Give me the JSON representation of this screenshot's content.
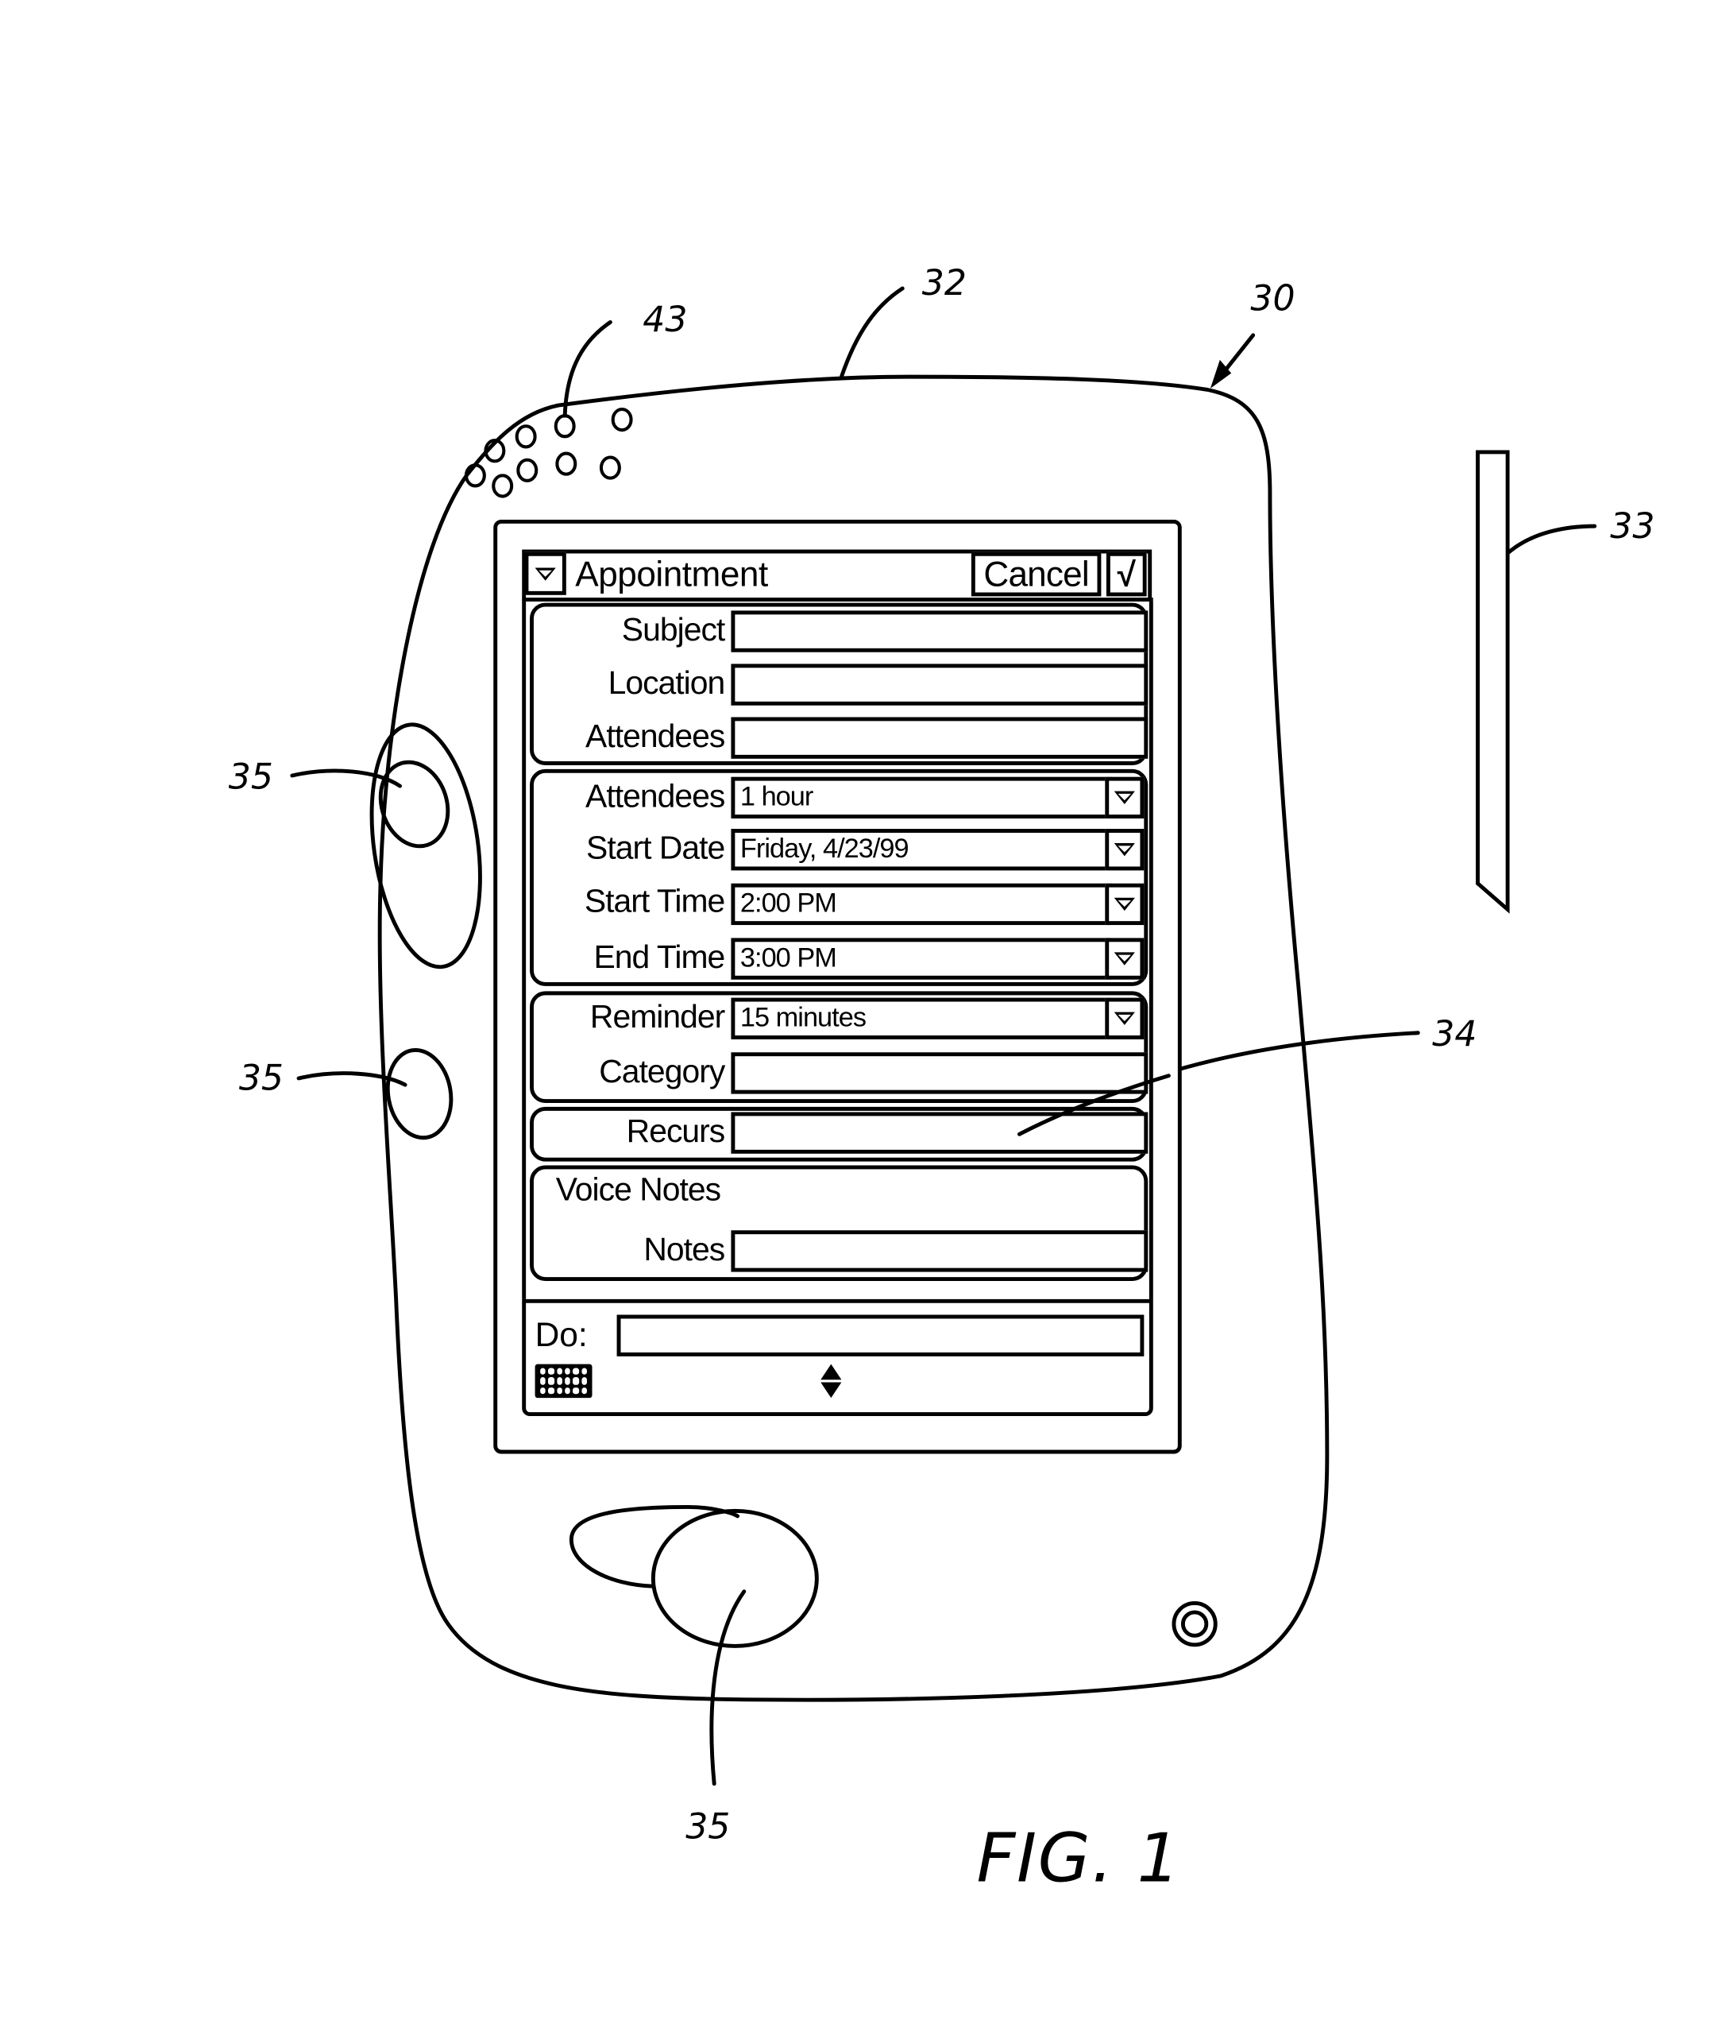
{
  "figure": {
    "label": "FIG. 1",
    "reference_numerals": {
      "device": "30",
      "housing": "32",
      "stylus": "33",
      "display": "34",
      "buttons": "35",
      "speaker": "43"
    }
  },
  "screen": {
    "title": "Appointment",
    "cancel_label": "Cancel",
    "ok_label": "√",
    "icons": {
      "menu": "triangle-down-icon",
      "dropdown": "triangle-down-icon",
      "keyboard": "keyboard-icon",
      "scroll": "up-down-arrows-icon"
    },
    "groups": [
      {
        "fields": [
          {
            "label": "Subject",
            "value": "",
            "dropdown": false
          },
          {
            "label": "Location",
            "value": "",
            "dropdown": false
          },
          {
            "label": "Attendees",
            "value": "",
            "dropdown": false
          }
        ]
      },
      {
        "fields": [
          {
            "label": "Attendees",
            "value": "1 hour",
            "dropdown": true
          },
          {
            "label": "Start Date",
            "value": "Friday, 4/23/99",
            "dropdown": true
          },
          {
            "label": "Start Time",
            "value": "2:00 PM",
            "dropdown": true
          },
          {
            "label": "End Time",
            "value": "3:00 PM",
            "dropdown": true
          }
        ]
      },
      {
        "fields": [
          {
            "label": "Reminder",
            "value": "15 minutes",
            "dropdown": true
          },
          {
            "label": "Category",
            "value": "",
            "dropdown": false
          }
        ]
      },
      {
        "fields": [
          {
            "label": "Recurs",
            "value": "",
            "dropdown": false
          }
        ]
      },
      {
        "heading": "Voice Notes",
        "fields": [
          {
            "label": "Notes",
            "value": "",
            "dropdown": false
          }
        ]
      }
    ],
    "command_bar": {
      "do_label": "Do:",
      "do_value": ""
    }
  }
}
